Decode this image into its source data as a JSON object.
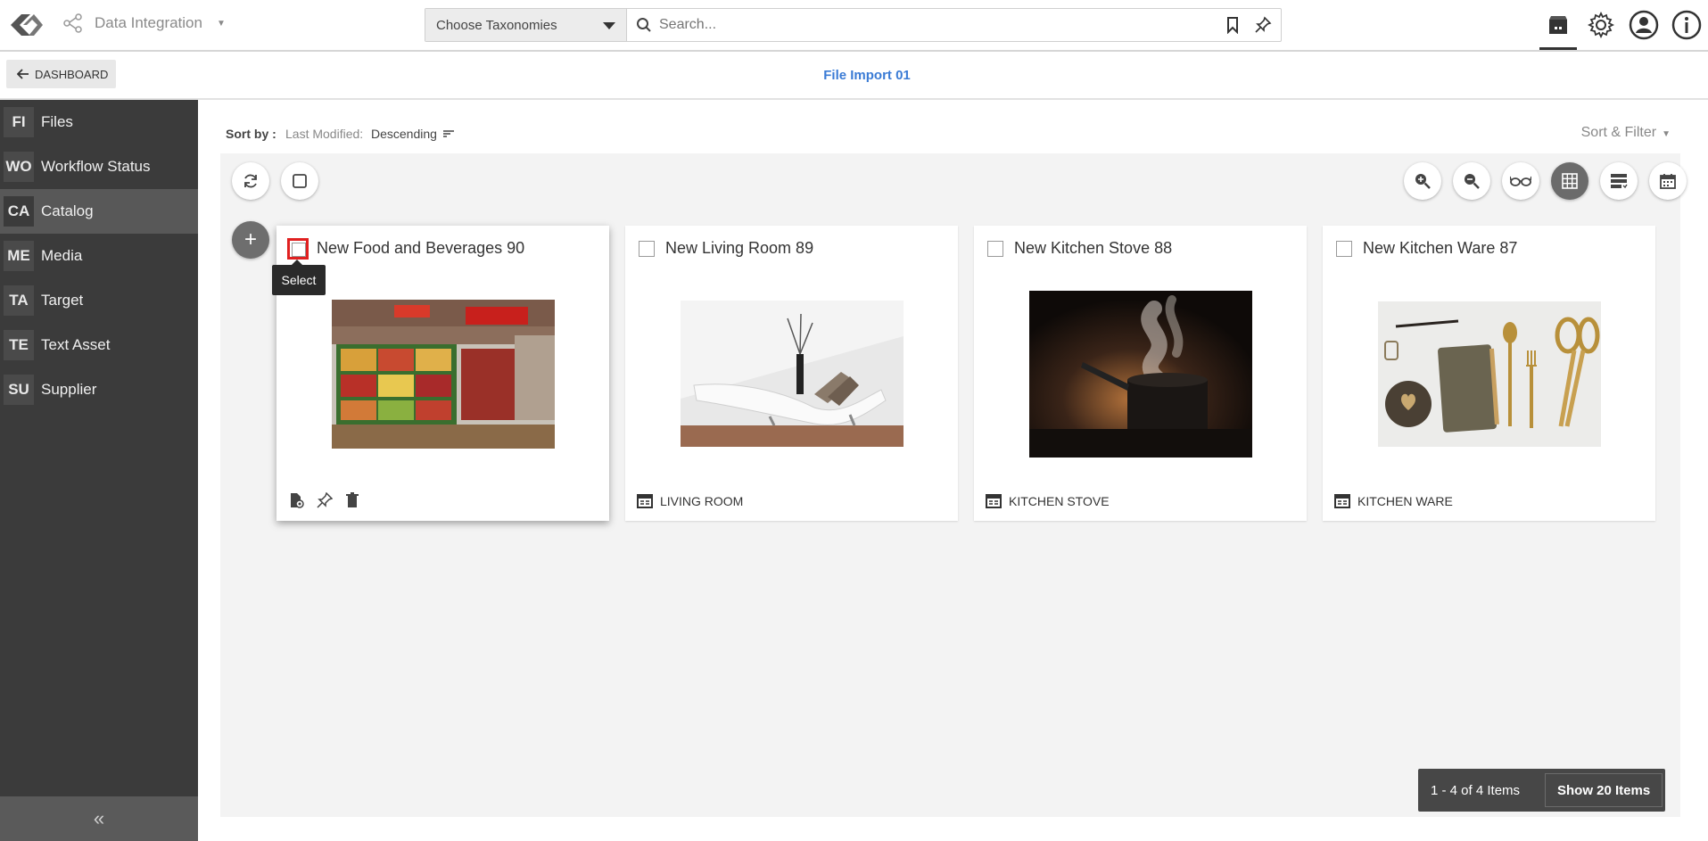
{
  "header": {
    "app_name": "Data Integration",
    "taxonomy_select": "Choose Taxonomies",
    "search_placeholder": "Search..."
  },
  "subheader": {
    "back_label": "DASHBOARD",
    "page_title": "File Import 01"
  },
  "sidebar": {
    "items": [
      {
        "abbr": "FI",
        "label": "Files"
      },
      {
        "abbr": "WO",
        "label": "Workflow Status"
      },
      {
        "abbr": "CA",
        "label": "Catalog",
        "active": true
      },
      {
        "abbr": "ME",
        "label": "Media"
      },
      {
        "abbr": "TA",
        "label": "Target"
      },
      {
        "abbr": "TE",
        "label": "Text Asset"
      },
      {
        "abbr": "SU",
        "label": "Supplier"
      }
    ],
    "collapse_glyph": "«"
  },
  "sort": {
    "label": "Sort by :",
    "field": "Last Modified:",
    "direction": "Descending",
    "filter_label": "Sort & Filter"
  },
  "tooltip": "Select",
  "cards": [
    {
      "title": "New Food and Beverages 90",
      "category": "",
      "image": "grocery-produce-photo"
    },
    {
      "title": "New Living Room 89",
      "category": "LIVING ROOM",
      "image": "white-chaise-lounge-photo"
    },
    {
      "title": "New Kitchen Stove 88",
      "category": "KITCHEN STOVE",
      "image": "steaming-pot-photo"
    },
    {
      "title": "New Kitchen Ware 87",
      "category": "KITCHEN WARE",
      "image": "gold-utensils-photo"
    }
  ],
  "pager": {
    "count": "1 - 4 of 4 Items",
    "show": "Show 20 Items"
  }
}
